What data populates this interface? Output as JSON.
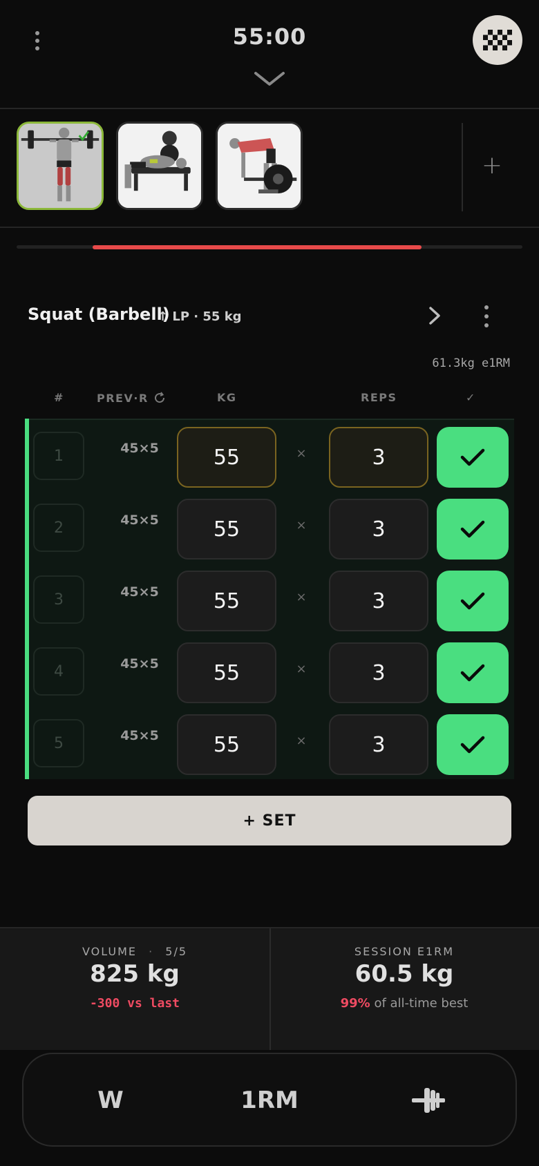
{
  "header": {
    "timer": "55:00"
  },
  "exercise": {
    "title": "Squat (Barbell)",
    "subtitle": "↑ LP · 55 kg",
    "e1rm": "61.3kg e1RM"
  },
  "progress": {
    "fraction": 0.65
  },
  "table": {
    "col_num": "#",
    "col_prev": "PREV·R",
    "col_kg": "KG",
    "col_reps": "REPS",
    "col_check": "✓",
    "times": "×",
    "rows": [
      {
        "num": "1",
        "prev": "45×5",
        "kg": "55",
        "reps": "3"
      },
      {
        "num": "2",
        "prev": "45×5",
        "kg": "55",
        "reps": "3"
      },
      {
        "num": "3",
        "prev": "45×5",
        "kg": "55",
        "reps": "3"
      },
      {
        "num": "4",
        "prev": "45×5",
        "kg": "55",
        "reps": "3"
      },
      {
        "num": "5",
        "prev": "45×5",
        "kg": "55",
        "reps": "3"
      }
    ]
  },
  "add_set_label": "+ SET",
  "stats": {
    "volume_label": "VOLUME",
    "volume_sep": "·",
    "volume_count": "5/5",
    "volume_value": "825 kg",
    "volume_delta": "-300 vs last",
    "e1rm_label": "SESSION E1RM",
    "e1rm_value": "60.5 kg",
    "e1rm_pct": "99%",
    "e1rm_pct_suffix": "of all-time best"
  },
  "nav": {
    "warmup": "W",
    "onerm": "1RM",
    "plate_icon": "plate-calculator-icon"
  },
  "colors": {
    "accent_green": "#4ade80",
    "accent_red": "#e84a4a",
    "active_thumb_border": "#8cb83a"
  }
}
